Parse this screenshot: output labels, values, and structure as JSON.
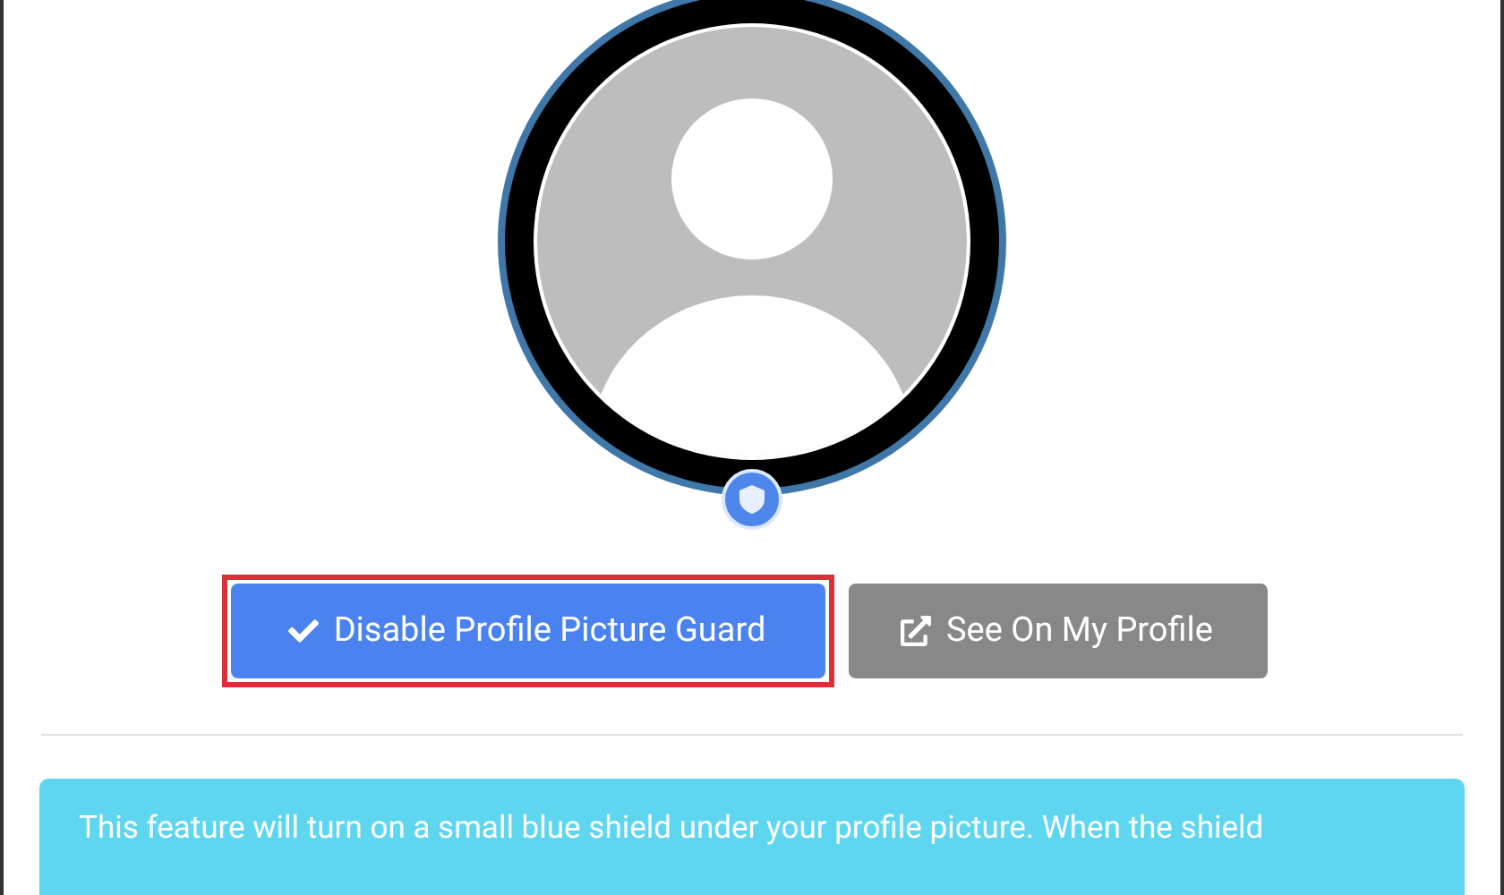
{
  "profile_picture": {
    "shield_visible": true
  },
  "buttons": [
    {
      "kind": "primary",
      "label": "Disable Profile Picture Guard",
      "highlighted": true
    },
    {
      "kind": "secondary",
      "label": "See On My Profile",
      "highlighted": false
    }
  ],
  "notice": {
    "text": "This feature will turn on a small blue shield under your profile picture. When the shield"
  }
}
